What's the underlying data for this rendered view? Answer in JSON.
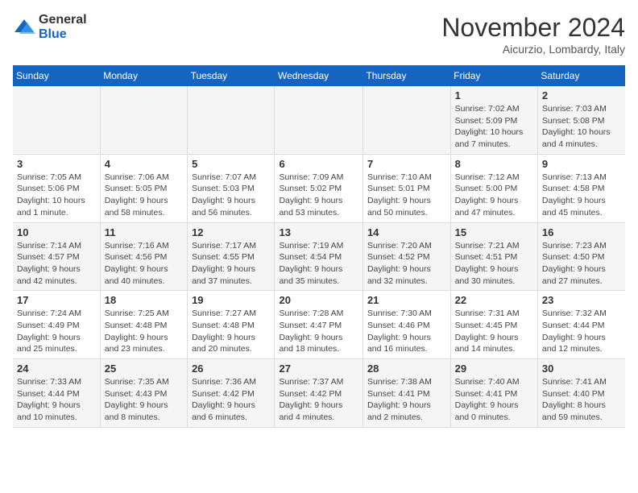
{
  "logo": {
    "general": "General",
    "blue": "Blue"
  },
  "title": "November 2024",
  "location": "Aicurzio, Lombardy, Italy",
  "weekdays": [
    "Sunday",
    "Monday",
    "Tuesday",
    "Wednesday",
    "Thursday",
    "Friday",
    "Saturday"
  ],
  "weeks": [
    [
      {
        "day": "",
        "info": ""
      },
      {
        "day": "",
        "info": ""
      },
      {
        "day": "",
        "info": ""
      },
      {
        "day": "",
        "info": ""
      },
      {
        "day": "",
        "info": ""
      },
      {
        "day": "1",
        "info": "Sunrise: 7:02 AM\nSunset: 5:09 PM\nDaylight: 10 hours\nand 7 minutes."
      },
      {
        "day": "2",
        "info": "Sunrise: 7:03 AM\nSunset: 5:08 PM\nDaylight: 10 hours\nand 4 minutes."
      }
    ],
    [
      {
        "day": "3",
        "info": "Sunrise: 7:05 AM\nSunset: 5:06 PM\nDaylight: 10 hours\nand 1 minute."
      },
      {
        "day": "4",
        "info": "Sunrise: 7:06 AM\nSunset: 5:05 PM\nDaylight: 9 hours\nand 58 minutes."
      },
      {
        "day": "5",
        "info": "Sunrise: 7:07 AM\nSunset: 5:03 PM\nDaylight: 9 hours\nand 56 minutes."
      },
      {
        "day": "6",
        "info": "Sunrise: 7:09 AM\nSunset: 5:02 PM\nDaylight: 9 hours\nand 53 minutes."
      },
      {
        "day": "7",
        "info": "Sunrise: 7:10 AM\nSunset: 5:01 PM\nDaylight: 9 hours\nand 50 minutes."
      },
      {
        "day": "8",
        "info": "Sunrise: 7:12 AM\nSunset: 5:00 PM\nDaylight: 9 hours\nand 47 minutes."
      },
      {
        "day": "9",
        "info": "Sunrise: 7:13 AM\nSunset: 4:58 PM\nDaylight: 9 hours\nand 45 minutes."
      }
    ],
    [
      {
        "day": "10",
        "info": "Sunrise: 7:14 AM\nSunset: 4:57 PM\nDaylight: 9 hours\nand 42 minutes."
      },
      {
        "day": "11",
        "info": "Sunrise: 7:16 AM\nSunset: 4:56 PM\nDaylight: 9 hours\nand 40 minutes."
      },
      {
        "day": "12",
        "info": "Sunrise: 7:17 AM\nSunset: 4:55 PM\nDaylight: 9 hours\nand 37 minutes."
      },
      {
        "day": "13",
        "info": "Sunrise: 7:19 AM\nSunset: 4:54 PM\nDaylight: 9 hours\nand 35 minutes."
      },
      {
        "day": "14",
        "info": "Sunrise: 7:20 AM\nSunset: 4:52 PM\nDaylight: 9 hours\nand 32 minutes."
      },
      {
        "day": "15",
        "info": "Sunrise: 7:21 AM\nSunset: 4:51 PM\nDaylight: 9 hours\nand 30 minutes."
      },
      {
        "day": "16",
        "info": "Sunrise: 7:23 AM\nSunset: 4:50 PM\nDaylight: 9 hours\nand 27 minutes."
      }
    ],
    [
      {
        "day": "17",
        "info": "Sunrise: 7:24 AM\nSunset: 4:49 PM\nDaylight: 9 hours\nand 25 minutes."
      },
      {
        "day": "18",
        "info": "Sunrise: 7:25 AM\nSunset: 4:48 PM\nDaylight: 9 hours\nand 23 minutes."
      },
      {
        "day": "19",
        "info": "Sunrise: 7:27 AM\nSunset: 4:48 PM\nDaylight: 9 hours\nand 20 minutes."
      },
      {
        "day": "20",
        "info": "Sunrise: 7:28 AM\nSunset: 4:47 PM\nDaylight: 9 hours\nand 18 minutes."
      },
      {
        "day": "21",
        "info": "Sunrise: 7:30 AM\nSunset: 4:46 PM\nDaylight: 9 hours\nand 16 minutes."
      },
      {
        "day": "22",
        "info": "Sunrise: 7:31 AM\nSunset: 4:45 PM\nDaylight: 9 hours\nand 14 minutes."
      },
      {
        "day": "23",
        "info": "Sunrise: 7:32 AM\nSunset: 4:44 PM\nDaylight: 9 hours\nand 12 minutes."
      }
    ],
    [
      {
        "day": "24",
        "info": "Sunrise: 7:33 AM\nSunset: 4:44 PM\nDaylight: 9 hours\nand 10 minutes."
      },
      {
        "day": "25",
        "info": "Sunrise: 7:35 AM\nSunset: 4:43 PM\nDaylight: 9 hours\nand 8 minutes."
      },
      {
        "day": "26",
        "info": "Sunrise: 7:36 AM\nSunset: 4:42 PM\nDaylight: 9 hours\nand 6 minutes."
      },
      {
        "day": "27",
        "info": "Sunrise: 7:37 AM\nSunset: 4:42 PM\nDaylight: 9 hours\nand 4 minutes."
      },
      {
        "day": "28",
        "info": "Sunrise: 7:38 AM\nSunset: 4:41 PM\nDaylight: 9 hours\nand 2 minutes."
      },
      {
        "day": "29",
        "info": "Sunrise: 7:40 AM\nSunset: 4:41 PM\nDaylight: 9 hours\nand 0 minutes."
      },
      {
        "day": "30",
        "info": "Sunrise: 7:41 AM\nSunset: 4:40 PM\nDaylight: 8 hours\nand 59 minutes."
      }
    ]
  ]
}
